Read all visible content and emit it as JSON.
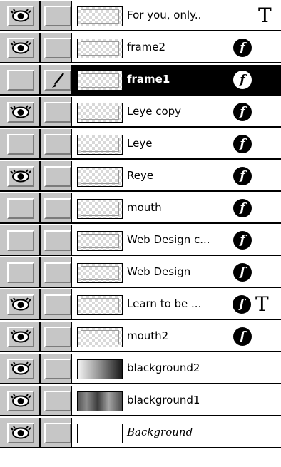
{
  "panel": "layers",
  "layers": [
    {
      "name": "For you, only..",
      "eye": true,
      "brush": false,
      "fx": false,
      "type_layer": true,
      "selected": false,
      "thumb": "checker"
    },
    {
      "name": "frame2",
      "eye": true,
      "brush": false,
      "fx": true,
      "type_layer": false,
      "selected": false,
      "thumb": "checker"
    },
    {
      "name": "frame1",
      "eye": false,
      "brush": true,
      "fx": true,
      "type_layer": false,
      "selected": true,
      "thumb": "checker"
    },
    {
      "name": "Leye copy",
      "eye": true,
      "brush": false,
      "fx": true,
      "type_layer": false,
      "selected": false,
      "thumb": "checker"
    },
    {
      "name": "Leye",
      "eye": false,
      "brush": false,
      "fx": true,
      "type_layer": false,
      "selected": false,
      "thumb": "checker"
    },
    {
      "name": "Reye",
      "eye": true,
      "brush": false,
      "fx": true,
      "type_layer": false,
      "selected": false,
      "thumb": "checker"
    },
    {
      "name": "mouth",
      "eye": false,
      "brush": false,
      "fx": true,
      "type_layer": false,
      "selected": false,
      "thumb": "checker"
    },
    {
      "name": "Web Design c...",
      "eye": false,
      "brush": false,
      "fx": true,
      "type_layer": false,
      "selected": false,
      "thumb": "checker"
    },
    {
      "name": "Web Design",
      "eye": false,
      "brush": false,
      "fx": true,
      "type_layer": false,
      "selected": false,
      "thumb": "checker"
    },
    {
      "name": "Learn to be ...",
      "eye": true,
      "brush": false,
      "fx": true,
      "type_layer": true,
      "selected": false,
      "thumb": "checker"
    },
    {
      "name": "mouth2",
      "eye": true,
      "brush": false,
      "fx": true,
      "type_layer": false,
      "selected": false,
      "thumb": "checker"
    },
    {
      "name": "blackground2",
      "eye": true,
      "brush": false,
      "fx": false,
      "type_layer": false,
      "selected": false,
      "thumb": "gradient"
    },
    {
      "name": "blackground1",
      "eye": true,
      "brush": false,
      "fx": false,
      "type_layer": false,
      "selected": false,
      "thumb": "photo"
    },
    {
      "name": "Background",
      "eye": true,
      "brush": false,
      "fx": false,
      "type_layer": false,
      "selected": false,
      "thumb": "blank",
      "italic": true
    }
  ],
  "glyphs": {
    "fx": "f",
    "type": "T"
  },
  "colors": {
    "selected_bg": "#000000",
    "control_gray": "#c6c6c6"
  }
}
